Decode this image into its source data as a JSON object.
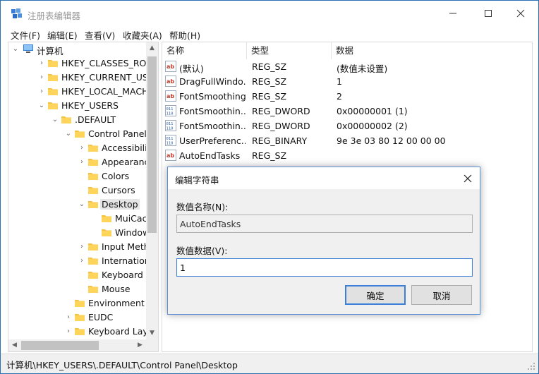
{
  "window": {
    "title": "注册表编辑器"
  },
  "menu": [
    "文件(F)",
    "编辑(E)",
    "查看(V)",
    "收藏夹(A)",
    "帮助(H)"
  ],
  "tree": [
    {
      "label": "计算机",
      "depth": 0,
      "twisty": "expanded",
      "icon": "computer-icon"
    },
    {
      "label": "HKEY_CLASSES_ROOT",
      "depth": 1,
      "twisty": "collapsed",
      "icon": "folder-icon"
    },
    {
      "label": "HKEY_CURRENT_USER",
      "depth": 1,
      "twisty": "collapsed",
      "icon": "folder-icon"
    },
    {
      "label": "HKEY_LOCAL_MACHINE",
      "depth": 1,
      "twisty": "collapsed",
      "icon": "folder-icon"
    },
    {
      "label": "HKEY_USERS",
      "depth": 1,
      "twisty": "expanded",
      "icon": "folder-icon"
    },
    {
      "label": ".DEFAULT",
      "depth": 2,
      "twisty": "expanded",
      "icon": "folder-icon"
    },
    {
      "label": "Control Panel",
      "depth": 3,
      "twisty": "expanded",
      "icon": "folder-icon"
    },
    {
      "label": "Accessibility",
      "depth": 4,
      "twisty": "collapsed",
      "icon": "folder-icon"
    },
    {
      "label": "Appearance",
      "depth": 4,
      "twisty": "collapsed",
      "icon": "folder-icon"
    },
    {
      "label": "Colors",
      "depth": 4,
      "twisty": "none",
      "icon": "folder-icon"
    },
    {
      "label": "Cursors",
      "depth": 4,
      "twisty": "none",
      "icon": "folder-icon"
    },
    {
      "label": "Desktop",
      "depth": 4,
      "twisty": "expanded",
      "icon": "folder-icon",
      "selected": true
    },
    {
      "label": "MuiCache",
      "depth": 5,
      "twisty": "none",
      "icon": "folder-icon"
    },
    {
      "label": "WindowM",
      "depth": 5,
      "twisty": "none",
      "icon": "folder-icon"
    },
    {
      "label": "Input Method",
      "depth": 4,
      "twisty": "collapsed",
      "icon": "folder-icon"
    },
    {
      "label": "International",
      "depth": 4,
      "twisty": "collapsed",
      "icon": "folder-icon"
    },
    {
      "label": "Keyboard",
      "depth": 4,
      "twisty": "none",
      "icon": "folder-icon"
    },
    {
      "label": "Mouse",
      "depth": 4,
      "twisty": "none",
      "icon": "folder-icon"
    },
    {
      "label": "Environment",
      "depth": 3,
      "twisty": "none",
      "icon": "folder-icon"
    },
    {
      "label": "EUDC",
      "depth": 3,
      "twisty": "collapsed",
      "icon": "folder-icon"
    },
    {
      "label": "Keyboard Layou",
      "depth": 3,
      "twisty": "collapsed",
      "icon": "folder-icon"
    }
  ],
  "list": {
    "columns": [
      "名称",
      "类型",
      "数据"
    ],
    "rows": [
      {
        "name": "(默认)",
        "type": "REG_SZ",
        "data": "(数值未设置)",
        "icon": "string-value-icon"
      },
      {
        "name": "DragFullWindo...",
        "type": "REG_SZ",
        "data": "1",
        "icon": "string-value-icon"
      },
      {
        "name": "FontSmoothing",
        "type": "REG_SZ",
        "data": "2",
        "icon": "string-value-icon"
      },
      {
        "name": "FontSmoothin...",
        "type": "REG_DWORD",
        "data": "0x00000001 (1)",
        "icon": "binary-value-icon"
      },
      {
        "name": "FontSmoothin...",
        "type": "REG_DWORD",
        "data": "0x00000002 (2)",
        "icon": "binary-value-icon"
      },
      {
        "name": "UserPreferenc...",
        "type": "REG_BINARY",
        "data": "9e 3e 03 80 12 00 00 00",
        "icon": "binary-value-icon"
      },
      {
        "name": "AutoEndTasks",
        "type": "REG_SZ",
        "data": "",
        "icon": "string-value-icon",
        "selected": true
      }
    ]
  },
  "status": {
    "path": "计算机\\HKEY_USERS\\.DEFAULT\\Control Panel\\Desktop"
  },
  "dialog": {
    "title": "编辑字符串",
    "name_label": "数值名称(N):",
    "name_value": "AutoEndTasks",
    "data_label": "数值数据(V):",
    "data_value": "1",
    "ok_label": "确定",
    "cancel_label": "取消"
  },
  "colors": {
    "accent": "#3c7fd8",
    "folder": "#f5c342",
    "selection": "#e5e5e5"
  }
}
